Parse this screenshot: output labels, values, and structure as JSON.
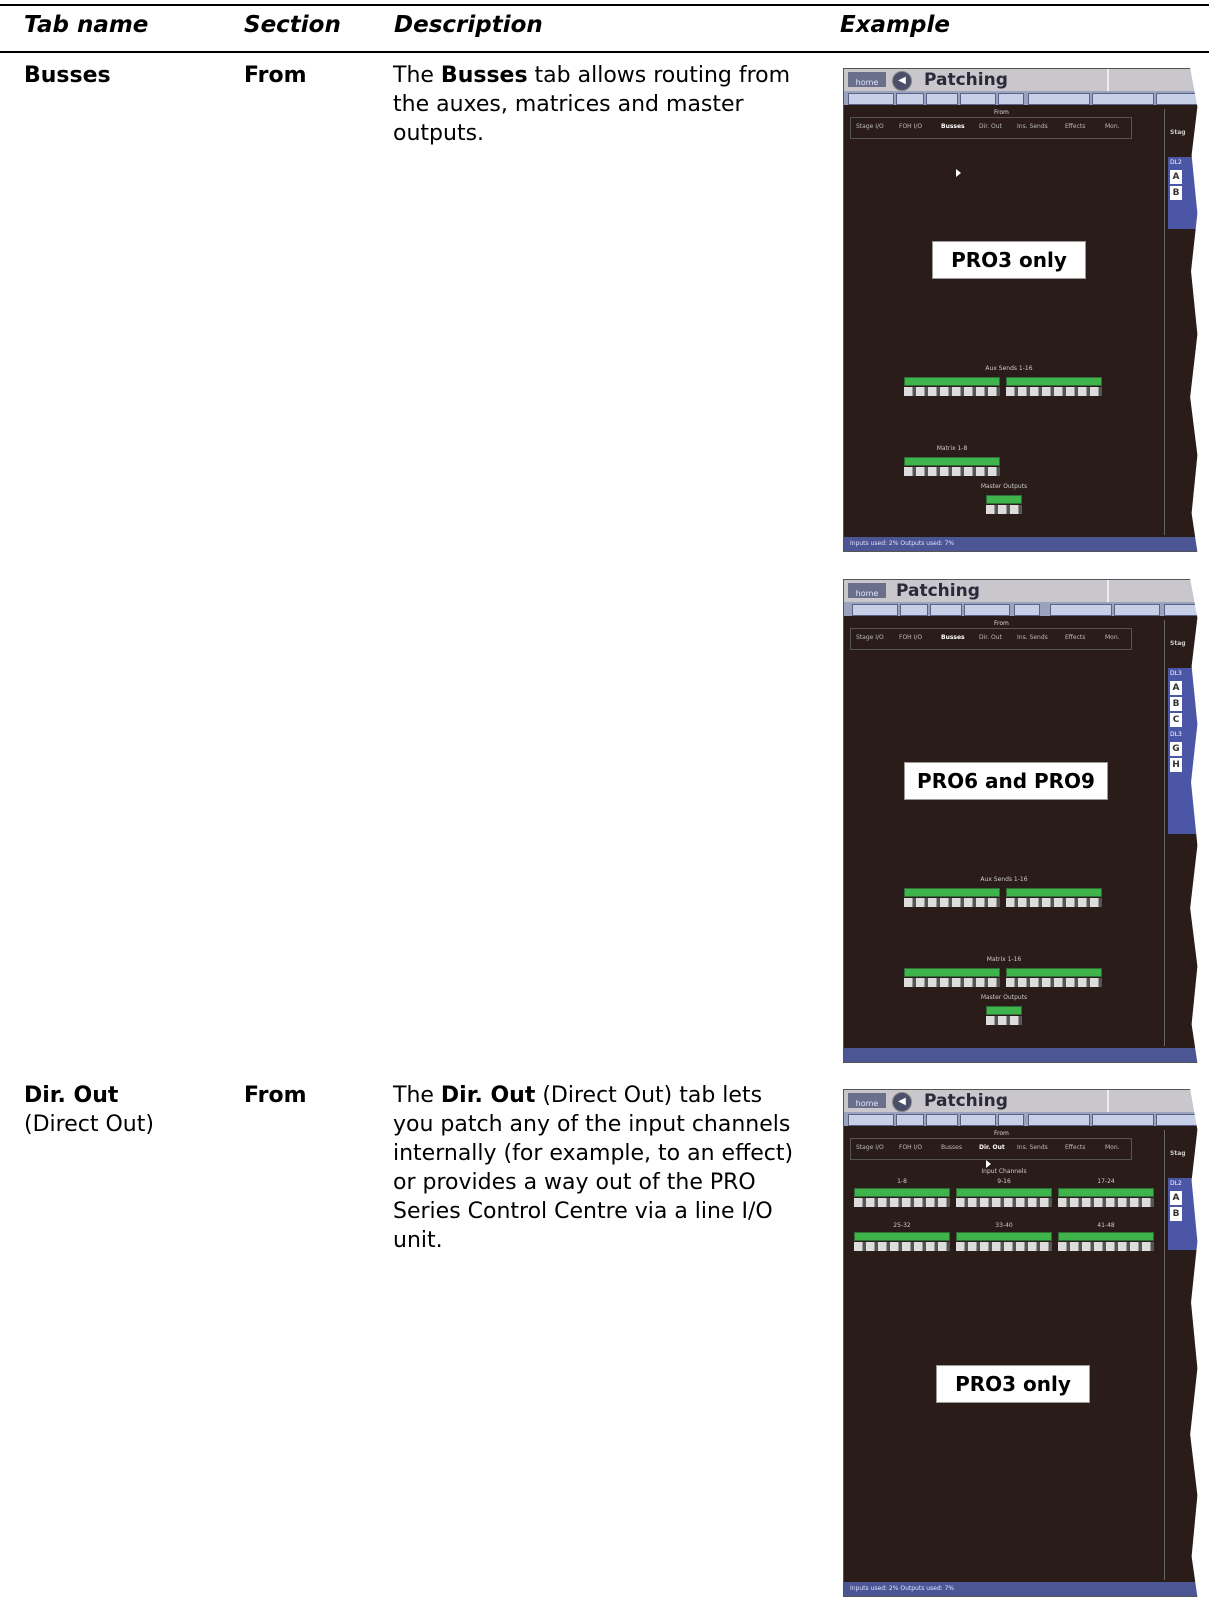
{
  "table": {
    "headers": [
      "Tab name",
      "Section",
      "Description",
      "Example"
    ],
    "rows": [
      {
        "tab_name": "Busses",
        "tab_sub": "",
        "section": "From",
        "desc_pre": "The ",
        "desc_bold": "Busses",
        "desc_post": " tab allows routing from the auxes, matrices and master outputs."
      },
      {
        "tab_name": "Dir. Out",
        "tab_sub": "(Direct Out)",
        "section": "From",
        "desc_pre": "The ",
        "desc_bold": "Dir. Out",
        "desc_post": " (Direct Out) tab lets you patch any of the input channels internally (for example, to an effect) or provides a way out of the PRO Series Control Centre via a line I/O unit."
      }
    ]
  },
  "screens": [
    {
      "title": "Patching",
      "home": "home",
      "from_label": "From",
      "tabs": [
        "Stage I/O",
        "FOH I/O",
        "Busses",
        "Dir. Out",
        "Ins. Sends",
        "Effects",
        "Mon."
      ],
      "right_head": "Stag",
      "right_bar1": "DL2",
      "right_letters": [
        "A",
        "B"
      ],
      "badge": "PRO3 only",
      "group_labels": [
        "Aux Sends 1-16",
        "Matrix 1-8",
        "Master Outputs"
      ],
      "status": "Inputs used: 2%      Outputs used: 7%"
    },
    {
      "title": "Patching",
      "home": "home",
      "from_label": "From",
      "tabs": [
        "Stage I/O",
        "FOH I/O",
        "Busses",
        "Dir. Out",
        "Ins. Sends",
        "Effects",
        "Mon."
      ],
      "right_head": "Stag",
      "right_bar1": "DL3",
      "right_letters": [
        "A",
        "B",
        "C"
      ],
      "right_bar2": "DL3",
      "right_letters2": [
        "G",
        "H"
      ],
      "badge": "PRO6 and PRO9",
      "group_labels": [
        "Aux Sends 1-16",
        "Matrix 1-16",
        "Master Outputs"
      ],
      "status": ""
    },
    {
      "title": "Patching",
      "home": "home",
      "from_label": "From",
      "tabs": [
        "Stage I/O",
        "FOH I/O",
        "Busses",
        "Dir. Out",
        "Ins. Sends",
        "Effects",
        "Mon."
      ],
      "right_head": "Stag",
      "right_bar1": "DL2",
      "right_letters": [
        "A",
        "B"
      ],
      "badge": "PRO3 only",
      "input_title": "Input Channels",
      "group_labels": [
        "1-8",
        "9-16",
        "17-24",
        "25-32",
        "33-40",
        "41-48"
      ],
      "status": "Inputs used: 2%      Outputs used: 7%"
    }
  ]
}
